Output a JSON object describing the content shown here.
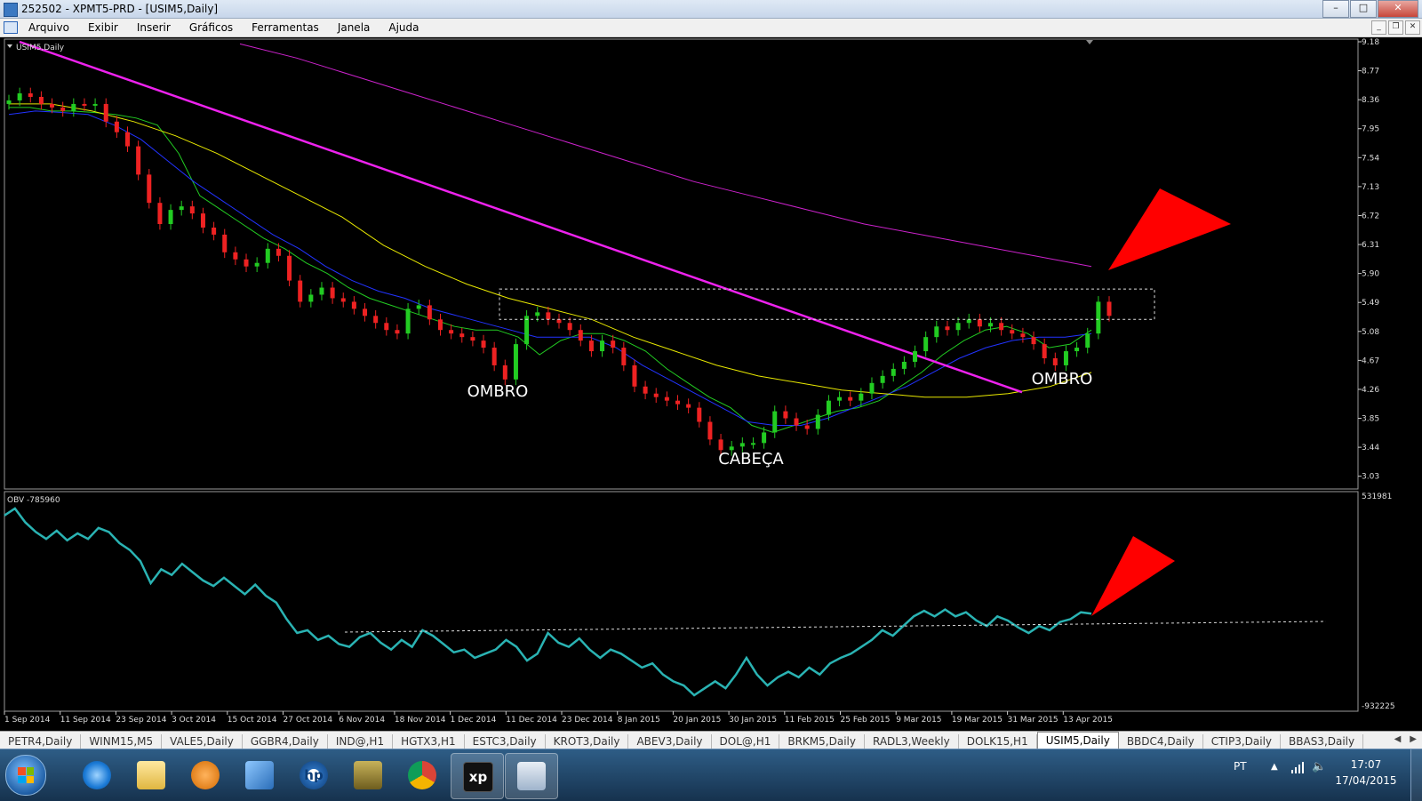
{
  "window": {
    "title": "252502 - XPMT5-PRD - [USIM5,Daily]",
    "minimize_glyph": "–",
    "maximize_glyph": "□",
    "close_glyph": "✕"
  },
  "menu": {
    "items": [
      "Arquivo",
      "Exibir",
      "Inserir",
      "Gráficos",
      "Ferramentas",
      "Janela",
      "Ajuda"
    ],
    "mdi_minimize": "_",
    "mdi_restore": "❐",
    "mdi_close": "✕"
  },
  "chart": {
    "symbol_label": "USIM5,Daily",
    "indicator_label": "OBV -785960",
    "annotations": {
      "left_shoulder": "OMBRO",
      "head": "CABEÇA",
      "right_shoulder": "OMBRO"
    },
    "colors": {
      "background": "#000000",
      "bull_candle": "#22cc22",
      "bear_candle": "#ee2222",
      "ma_fast": "#22cc22",
      "ma_mid": "#2233ff",
      "ma_slow": "#e8e800",
      "ma_long": "#cc22cc",
      "trendline": "#ee22ee",
      "obv_line": "#2ab3b3",
      "arrow": "#ff0000"
    }
  },
  "chart_data": [
    {
      "type": "candlestick",
      "symbol": "USIM5",
      "timeframe": "Daily",
      "y_ticks": [
        "9.18",
        "8.77",
        "8.36",
        "7.95",
        "7.54",
        "7.13",
        "6.72",
        "6.31",
        "5.90",
        "5.49",
        "5.08",
        "4.67",
        "4.26",
        "3.85",
        "3.44",
        "3.03"
      ],
      "ylim": [
        2.85,
        9.18
      ],
      "x_ticks": [
        "1 Sep 2014",
        "11 Sep 2014",
        "23 Sep 2014",
        "3 Oct 2014",
        "15 Oct 2014",
        "27 Oct 2014",
        "6 Nov 2014",
        "18 Nov 2014",
        "1 Dec 2014",
        "11 Dec 2014",
        "23 Dec 2014",
        "8 Jan 2015",
        "20 Jan 2015",
        "30 Jan 2015",
        "11 Feb 2015",
        "25 Feb 2015",
        "9 Mar 2015",
        "19 Mar 2015",
        "31 Mar 2015",
        "13 Apr 2015"
      ],
      "close_path": [
        8.35,
        8.45,
        8.4,
        8.3,
        8.25,
        8.2,
        8.3,
        8.28,
        8.3,
        8.05,
        7.9,
        7.7,
        7.3,
        6.9,
        6.6,
        6.8,
        6.85,
        6.75,
        6.55,
        6.45,
        6.2,
        6.1,
        6.0,
        6.05,
        6.25,
        6.15,
        5.8,
        5.5,
        5.6,
        5.7,
        5.55,
        5.5,
        5.4,
        5.3,
        5.2,
        5.1,
        5.05,
        5.4,
        5.45,
        5.25,
        5.1,
        5.05,
        5.0,
        4.95,
        4.85,
        4.6,
        4.4,
        4.9,
        5.3,
        5.35,
        5.25,
        5.2,
        5.1,
        4.95,
        4.8,
        4.95,
        4.85,
        4.6,
        4.3,
        4.2,
        4.15,
        4.1,
        4.05,
        4.0,
        3.8,
        3.55,
        3.4,
        3.45,
        3.5,
        3.5,
        3.65,
        3.95,
        3.85,
        3.75,
        3.7,
        3.9,
        4.1,
        4.15,
        4.1,
        4.2,
        4.35,
        4.45,
        4.55,
        4.65,
        4.8,
        5.0,
        5.15,
        5.1,
        5.2,
        5.25,
        5.15,
        5.2,
        5.1,
        5.05,
        5.0,
        4.9,
        4.7,
        4.6,
        4.8,
        4.85,
        5.05,
        5.5,
        5.3
      ],
      "moving_averages": [
        {
          "name": "fast",
          "values": [
            8.25,
            8.25,
            8.2,
            8.2,
            8.18,
            8.15,
            8.1,
            8.0,
            7.6,
            7.0,
            6.8,
            6.6,
            6.4,
            6.25,
            6.05,
            5.9,
            5.7,
            5.55,
            5.45,
            5.35,
            5.25,
            5.15,
            5.1,
            5.1,
            5.0,
            4.75,
            4.95,
            5.05,
            5.05,
            4.95,
            4.8,
            4.55,
            4.35,
            4.15,
            4.0,
            3.75,
            3.65,
            3.75,
            3.85,
            3.95,
            4.0,
            4.1,
            4.3,
            4.5,
            4.75,
            4.95,
            5.1,
            5.15,
            5.05,
            4.85,
            4.9,
            5.1
          ]
        },
        {
          "name": "mid",
          "values": [
            8.15,
            8.2,
            8.18,
            8.15,
            8.0,
            7.8,
            7.5,
            7.2,
            6.95,
            6.7,
            6.45,
            6.25,
            6.0,
            5.8,
            5.65,
            5.55,
            5.4,
            5.3,
            5.2,
            5.1,
            5.0,
            5.0,
            5.0,
            4.85,
            4.6,
            4.4,
            4.2,
            4.0,
            3.8,
            3.75,
            3.75,
            3.85,
            4.0,
            4.15,
            4.3,
            4.5,
            4.7,
            4.85,
            4.95,
            5.0,
            5.0,
            5.05
          ]
        },
        {
          "name": "slow",
          "values": [
            8.3,
            8.3,
            8.2,
            8.05,
            7.85,
            7.6,
            7.3,
            7.0,
            6.7,
            6.3,
            6.0,
            5.75,
            5.55,
            5.4,
            5.25,
            5.0,
            4.8,
            4.6,
            4.45,
            4.35,
            4.25,
            4.2,
            4.15,
            4.15,
            4.2,
            4.3,
            4.5
          ]
        },
        {
          "name": "long",
          "values": [
            9.15,
            8.95,
            8.7,
            8.45,
            8.2,
            7.95,
            7.7,
            7.45,
            7.2,
            7.0,
            6.8,
            6.6,
            6.45,
            6.3,
            6.15,
            6.0
          ]
        }
      ],
      "annotations": [
        "OMBRO",
        "CABEÇA",
        "OMBRO"
      ]
    },
    {
      "type": "line",
      "name": "OBV",
      "current_label": "OBV -785960",
      "y_ticks": [
        "531981",
        "-932225"
      ],
      "ylim": [
        -932225,
        531981
      ],
      "values": [
        0.95,
        1.0,
        0.9,
        0.83,
        0.78,
        0.84,
        0.77,
        0.82,
        0.78,
        0.86,
        0.83,
        0.75,
        0.7,
        0.62,
        0.46,
        0.56,
        0.52,
        0.6,
        0.54,
        0.48,
        0.44,
        0.5,
        0.44,
        0.38,
        0.45,
        0.37,
        0.32,
        0.2,
        0.1,
        0.12,
        0.05,
        0.08,
        0.02,
        0.0,
        0.07,
        0.1,
        0.03,
        -0.02,
        0.05,
        0.0,
        0.12,
        0.08,
        0.02,
        -0.04,
        -0.02,
        -0.08,
        -0.05,
        -0.02,
        0.05,
        0.0,
        -0.1,
        -0.05,
        0.1,
        0.03,
        0.0,
        0.06,
        -0.02,
        -0.08,
        -0.02,
        -0.05,
        -0.1,
        -0.15,
        -0.12,
        -0.2,
        -0.25,
        -0.28,
        -0.35,
        -0.3,
        -0.25,
        -0.3,
        -0.2,
        -0.08,
        -0.2,
        -0.28,
        -0.22,
        -0.18,
        -0.22,
        -0.15,
        -0.2,
        -0.12,
        -0.08,
        -0.05,
        0.0,
        0.05,
        0.12,
        0.08,
        0.15,
        0.22,
        0.26,
        0.22,
        0.27,
        0.22,
        0.25,
        0.19,
        0.15,
        0.22,
        0.19,
        0.14,
        0.1,
        0.15,
        0.12,
        0.18,
        0.2,
        0.25,
        0.24
      ]
    }
  ],
  "tabs": [
    {
      "label": "PETR4,Daily",
      "active": false
    },
    {
      "label": "WINM15,M5",
      "active": false
    },
    {
      "label": "VALE5,Daily",
      "active": false
    },
    {
      "label": "GGBR4,Daily",
      "active": false
    },
    {
      "label": "IND@,H1",
      "active": false
    },
    {
      "label": "HGTX3,H1",
      "active": false
    },
    {
      "label": "ESTC3,Daily",
      "active": false
    },
    {
      "label": "KROT3,Daily",
      "active": false
    },
    {
      "label": "ABEV3,Daily",
      "active": false
    },
    {
      "label": "DOL@,H1",
      "active": false
    },
    {
      "label": "BRKM5,Daily",
      "active": false
    },
    {
      "label": "RADL3,Weekly",
      "active": false
    },
    {
      "label": "DOLK15,H1",
      "active": false
    },
    {
      "label": "USIM5,Daily",
      "active": true
    },
    {
      "label": "BBDC4,Daily",
      "active": false
    },
    {
      "label": "CTIP3,Daily",
      "active": false
    },
    {
      "label": "BBAS3,Daily",
      "active": false
    }
  ],
  "tab_arrows": {
    "left": "◀",
    "right": "▶"
  },
  "taskbar": {
    "icons": [
      "internet-explorer-icon",
      "folder-icon",
      "media-player-icon",
      "network-icon",
      "hp-icon",
      "package-icon",
      "chrome-icon",
      "xp-icon",
      "trading-app-icon"
    ],
    "xp_label": "xp",
    "hp_label": "hp",
    "language": "PT",
    "time": "17:07",
    "date": "17/04/2015"
  }
}
